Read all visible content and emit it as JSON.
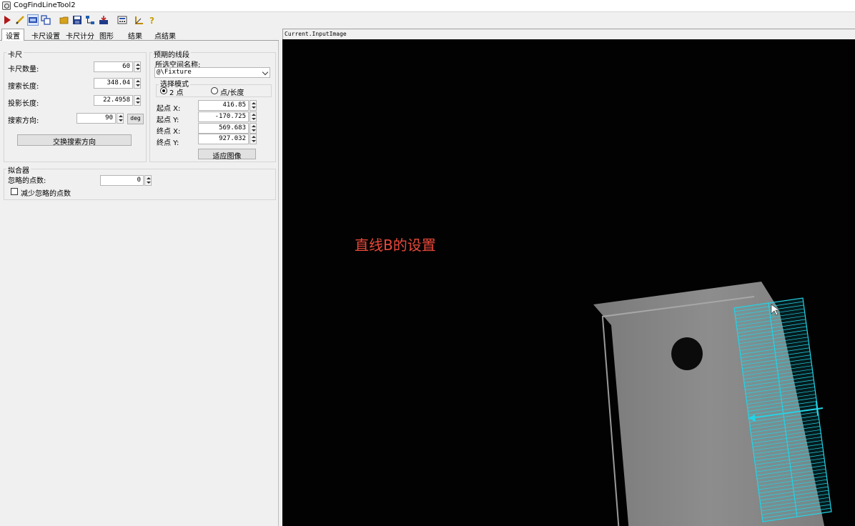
{
  "window": {
    "title": "CogFindLineTool2"
  },
  "toolbar": {
    "items": [
      {
        "name": "run-icon",
        "color": "#b01818"
      },
      {
        "name": "pencil-icon",
        "color": "#d4a000"
      },
      {
        "name": "image-display-icon",
        "color": "#2a4fb0"
      },
      {
        "name": "copy-icon",
        "color": "#2a4fb0"
      },
      {
        "name": "open-folder-icon",
        "color": "#d8a21c"
      },
      {
        "name": "save-icon",
        "color": "#1f3c8a"
      },
      {
        "name": "network-icon",
        "color": "#1f5fb0"
      },
      {
        "name": "load-image-icon",
        "color": "#c02020"
      },
      {
        "name": "calculator-icon",
        "color": "#444444"
      },
      {
        "name": "ruler-icon",
        "color": "#c08a00"
      },
      {
        "name": "help-icon",
        "color": "#c8a000"
      }
    ]
  },
  "tabs": [
    {
      "label": "设置",
      "active": true
    },
    {
      "label": "卡尺设置"
    },
    {
      "label": "卡尺计分"
    },
    {
      "label": "图形"
    },
    {
      "label": "结果"
    },
    {
      "label": "点结果"
    }
  ],
  "caliper": {
    "title": "卡尺",
    "count_label": "卡尺数量:",
    "count_value": "60",
    "search_length_label": "搜索长度:",
    "search_length_value": "348.04",
    "projection_length_label": "投影长度:",
    "projection_length_value": "22.4958",
    "search_direction_label": "搜索方向:",
    "search_direction_value": "90",
    "deg_label": "deg",
    "swap_button": "交换搜索方向"
  },
  "expected": {
    "title": "预期的线段",
    "space_label": "所选空间名称:",
    "space_value": "@\\Fixture",
    "mode_title": "选择模式",
    "mode_two_point": "2 点",
    "mode_point_length": "点/长度",
    "start_x_label": "起点 X:",
    "start_x_value": "416.85",
    "start_y_label": "起点 Y:",
    "start_y_value": "-170.725",
    "end_x_label": "终点 X:",
    "end_x_value": "569.683",
    "end_y_label": "终点 Y:",
    "end_y_value": "927.032",
    "fit_button": "适应图像"
  },
  "fitter": {
    "title": "拟合器",
    "ignore_label": "忽略的点数:",
    "ignore_value": "0",
    "reduce_label": "减少忽略的点数"
  },
  "display": {
    "caption": "Current.InputImage",
    "overlay_text": "直线B的设置",
    "region_color": "#22d3e6"
  }
}
